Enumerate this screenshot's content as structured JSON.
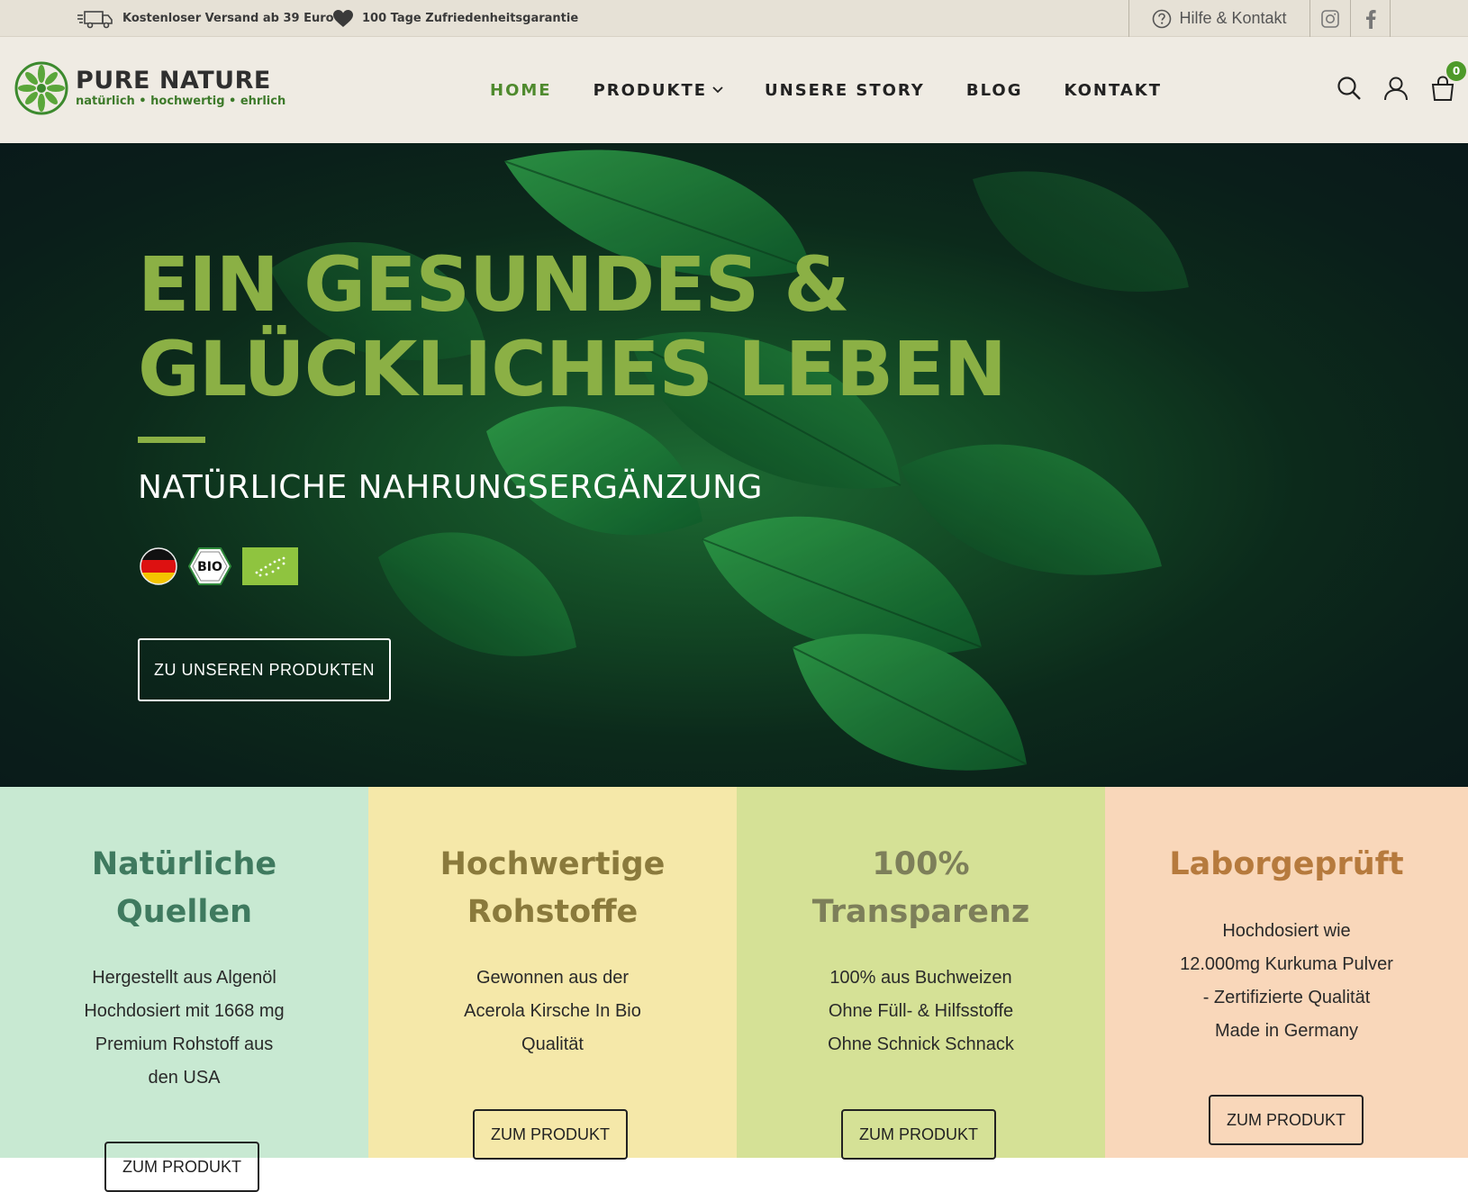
{
  "topbar": {
    "shipping": "Kostenloser Versand ab 39 Euro",
    "guarantee": "100 Tage Zufriedenheitsgarantie",
    "help": "Hilfe & Kontakt"
  },
  "header": {
    "brand_name": "PURE NATURE",
    "tagline": "natürlich • hochwertig • ehrlich",
    "nav": [
      "HOME",
      "PRODUKTE",
      "UNSERE STORY",
      "BLOG",
      "KONTAKT"
    ],
    "active_nav": "HOME",
    "cart_count": "0"
  },
  "hero": {
    "title_line1": "EIN GESUNDES &",
    "title_line2": "GLÜCKLICHES LEBEN",
    "subtitle": "NATÜRLICHE NAHRUNGSERGÄNZUNG",
    "bio_badge": "BIO",
    "cta": "ZU UNSEREN PRODUKTEN"
  },
  "features": [
    {
      "title_line1": "Natürliche",
      "title_line2": "Quellen",
      "lines": [
        "Hergestellt aus Algenöl",
        "Hochdosiert mit 1668 mg",
        "Premium Rohstoff aus",
        "den USA"
      ],
      "button": "ZUM PRODUKT",
      "bg": "#c8e9d2",
      "title_color": "#3f7a5f"
    },
    {
      "title_line1": "Hochwertige",
      "title_line2": "Rohstoffe",
      "lines": [
        "Gewonnen aus der",
        "Acerola Kirsche In Bio",
        "Qualität"
      ],
      "button": "ZUM PRODUKT",
      "bg": "#f5e8a9",
      "title_color": "#8a7a3c"
    },
    {
      "title_line1": "100%",
      "title_line2": "Transparenz",
      "lines": [
        "100% aus Buchweizen",
        "Ohne Füll- & Hilfsstoffe",
        "Ohne Schnick Schnack"
      ],
      "button": "ZUM PRODUKT",
      "bg": "#d5e196",
      "title_color": "#7d7f5a"
    },
    {
      "title_line1": "Laborgeprüft",
      "title_line2": "",
      "lines": [
        "Hochdosiert wie",
        "12.000mg Kurkuma Pulver",
        "- Zertifizierte Qualität",
        "Made in Germany"
      ],
      "button": "ZUM PRODUKT",
      "bg": "#f9d7ba",
      "title_color": "#b67a3d"
    }
  ],
  "colors": {
    "accent_green": "#8bb045",
    "nav_active": "#4f8a2e"
  }
}
